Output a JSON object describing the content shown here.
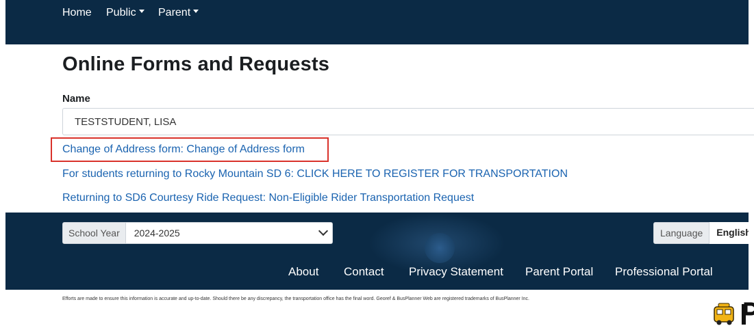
{
  "nav": {
    "home": "Home",
    "public": "Public",
    "parent": "Parent"
  },
  "page": {
    "title": "Online Forms and Requests"
  },
  "form": {
    "name_label": "Name",
    "name_value": "TESTSTUDENT, LISA"
  },
  "links": [
    "Change of Address form: Change of Address form",
    "For students returning to Rocky Mountain SD 6: CLICK HERE TO REGISTER FOR TRANSPORTATION",
    "Returning to SD6 Courtesy Ride Request: Non-Eligible Rider Transportation Request"
  ],
  "footer": {
    "school_year_label": "School Year",
    "school_year_value": "2024-2025",
    "language_label": "Language",
    "language_value": "English",
    "links": [
      "About",
      "Contact",
      "Privacy Statement",
      "Parent Portal",
      "Professional Portal"
    ]
  },
  "disclaimer": "Efforts are made to ensure this information is accurate and up-to-date. Should there be any discrepancy, the transportation office has the final word. Georef & BusPlanner Web are registered trademarks of BusPlanner Inc.",
  "colors": {
    "navbar": "#0b2a45",
    "link": "#1a63b0",
    "highlight": "#d9312a"
  },
  "icons": {
    "bus_logo": "school-bus-icon",
    "dropdown": "chevron-down-icon",
    "caret": "caret-down-icon"
  }
}
